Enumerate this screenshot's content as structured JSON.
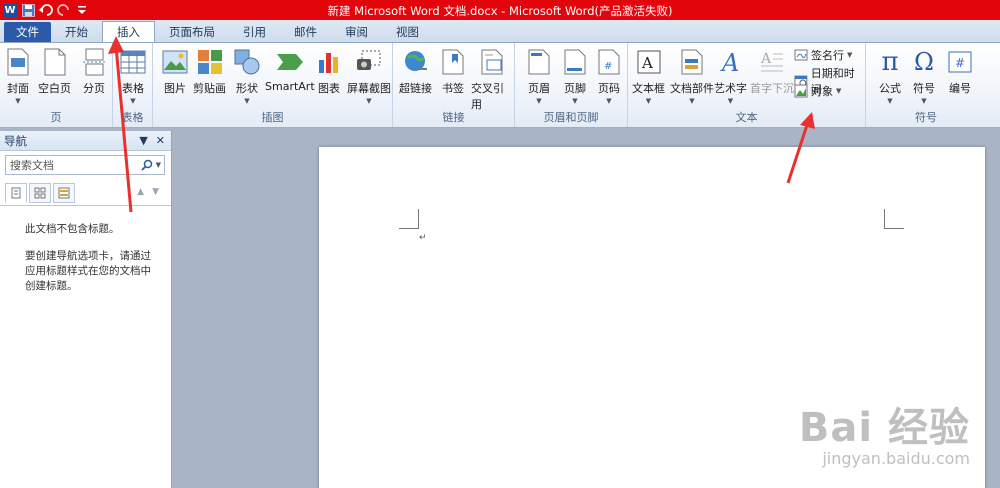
{
  "window": {
    "title": "新建 Microsoft Word 文档.docx  -  Microsoft Word(产品激活失败)"
  },
  "qat": {
    "logo": "W",
    "icons": [
      "save-icon",
      "undo-icon",
      "redo-icon",
      "customize-icon"
    ]
  },
  "tabs": [
    {
      "label": "文件"
    },
    {
      "label": "开始"
    },
    {
      "label": "插入"
    },
    {
      "label": "页面布局"
    },
    {
      "label": "引用"
    },
    {
      "label": "邮件"
    },
    {
      "label": "审阅"
    },
    {
      "label": "视图"
    }
  ],
  "ribbon": {
    "groups": {
      "pages": "页",
      "tables": "表格",
      "illustrations": "插图",
      "links": "链接",
      "header_footer": "页眉和页脚",
      "text": "文本",
      "symbols": "符号"
    },
    "buttons": {
      "cover": "封面",
      "blank_page": "空白页",
      "page_break": "分页",
      "table": "表格",
      "picture": "图片",
      "clipart": "剪贴画",
      "shapes": "形状",
      "smartart": "SmartArt",
      "chart": "图表",
      "screenshot": "屏幕截图",
      "hyperlink": "超链接",
      "bookmark": "书签",
      "cross_ref": "交叉引用",
      "header": "页眉",
      "footer": "页脚",
      "page_number": "页码",
      "textbox": "文本框",
      "quick_parts": "文档部件",
      "wordart": "艺术字",
      "dropcap": "首字下沉",
      "signature": "签名行",
      "datetime": "日期和时间",
      "object": "对象",
      "equation": "公式",
      "symbol": "符号",
      "number": "编号"
    }
  },
  "nav": {
    "title": "导航",
    "search_placeholder": "搜索文档",
    "message1": "此文档不包含标题。",
    "message2": "要创建导航选项卡，请通过应用标题样式在您的文档中创建标题。"
  },
  "document": {
    "paragraph_mark": "↵"
  },
  "watermark": {
    "main": "Bai  经验",
    "sub": "jingyan.baidu.com"
  },
  "colors": {
    "title_bar": "#e2050c",
    "file_tab": "#2a5aa8",
    "annotation_arrow": "#e8312f"
  }
}
